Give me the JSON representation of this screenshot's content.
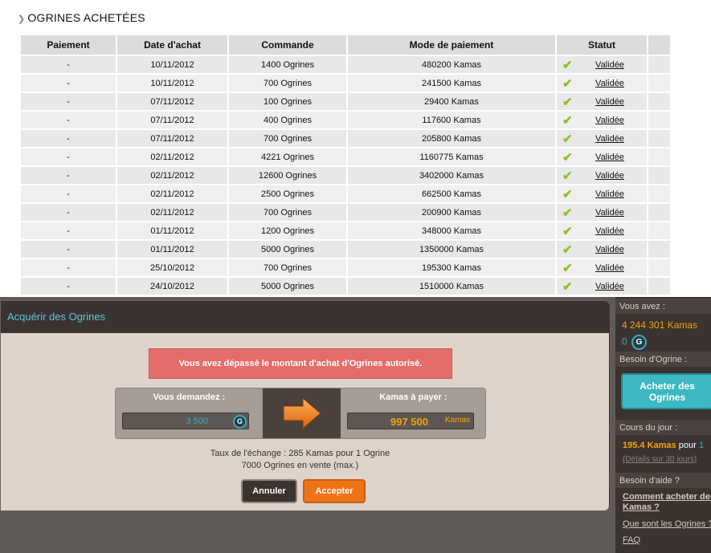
{
  "section": {
    "title": "OGRINES ACHETÉES"
  },
  "table": {
    "headers": [
      "Paiement",
      "Date d'achat",
      "Commande",
      "Mode de paiement",
      "Statut"
    ],
    "rows": [
      {
        "paiement": "-",
        "date": "10/11/2012",
        "commande": "1400 Ogrines",
        "mode": "480200 Kamas",
        "statut": "Validée"
      },
      {
        "paiement": "-",
        "date": "10/11/2012",
        "commande": "700 Ogrines",
        "mode": "241500 Kamas",
        "statut": "Validée"
      },
      {
        "paiement": "-",
        "date": "07/11/2012",
        "commande": "100 Ogrines",
        "mode": "29400 Kamas",
        "statut": "Validée"
      },
      {
        "paiement": "-",
        "date": "07/11/2012",
        "commande": "400 Ogrines",
        "mode": "117600 Kamas",
        "statut": "Validée"
      },
      {
        "paiement": "-",
        "date": "07/11/2012",
        "commande": "700 Ogrines",
        "mode": "205800 Kamas",
        "statut": "Validée"
      },
      {
        "paiement": "-",
        "date": "02/11/2012",
        "commande": "4221 Ogrines",
        "mode": "1160775 Kamas",
        "statut": "Validée"
      },
      {
        "paiement": "-",
        "date": "02/11/2012",
        "commande": "12600 Ogrines",
        "mode": "3402000 Kamas",
        "statut": "Validée"
      },
      {
        "paiement": "-",
        "date": "02/11/2012",
        "commande": "2500 Ogrines",
        "mode": "662500 Kamas",
        "statut": "Validée"
      },
      {
        "paiement": "-",
        "date": "02/11/2012",
        "commande": "700 Ogrines",
        "mode": "200900 Kamas",
        "statut": "Validée"
      },
      {
        "paiement": "-",
        "date": "01/11/2012",
        "commande": "1200 Ogrines",
        "mode": "348000 Kamas",
        "statut": "Validée"
      },
      {
        "paiement": "-",
        "date": "01/11/2012",
        "commande": "5000 Ogrines",
        "mode": "1350000 Kamas",
        "statut": "Validée"
      },
      {
        "paiement": "-",
        "date": "25/10/2012",
        "commande": "700 Ogrines",
        "mode": "195300 Kamas",
        "statut": "Validée"
      },
      {
        "paiement": "-",
        "date": "24/10/2012",
        "commande": "5000 Ogrines",
        "mode": "1510000 Kamas",
        "statut": "Validée"
      }
    ]
  },
  "modal": {
    "title": "Acquérir des Ogrines",
    "alert": "Vous avez dépassé le montant d'achat d'Ogrines autorisé.",
    "request_label": "Vous demandez :",
    "request_value": "3 500",
    "pay_label": "Kamas à payer :",
    "pay_value": "997 500",
    "pay_unit": "Kamas",
    "rate_text": "Taux de l'échange : 285 Kamas pour 1 Ogrine",
    "stock_text": "7000 Ogrines en vente (max.)",
    "cancel_label": "Annuler",
    "accept_label": "Accepter"
  },
  "sidebar": {
    "you_have_label": "Vous avez :",
    "kamas_balance": "4 244 301 Kamas",
    "ogrines_balance": "0",
    "need_label": "Besoin d'Ogrine :",
    "buy_button_label": "Acheter des Ogrines",
    "daily_rate_label": "Cours du jour :",
    "daily_rate_value": "195.4 Kamas",
    "daily_rate_pour": "pour",
    "daily_rate_one": "1",
    "details_link": "(Détails sur 30 jours)",
    "help_label": "Besoin d'aide ?",
    "help_link_1": "Comment acheter des Kamas ?",
    "help_link_2": "Que sont les Ogrines ?",
    "faq_link": "FAQ"
  },
  "colors": {
    "accent_teal": "#3fa9bf",
    "kamas_orange": "#f4a30a",
    "alert_red": "#e46d6b",
    "accept_orange": "#ef7315",
    "check_green": "#8fbf2a"
  },
  "icons": {
    "ogrine_coin": "ogrine-coin-icon",
    "check": "check-icon",
    "arrow": "arrow-right-icon",
    "chevron": "chevron-right-icon"
  }
}
